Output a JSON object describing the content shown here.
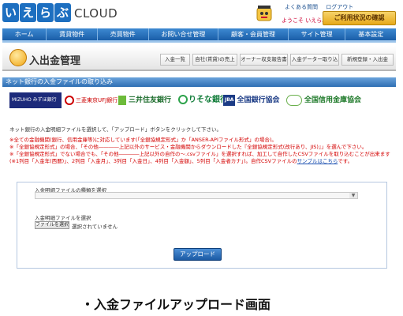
{
  "header": {
    "logo_chars": [
      "い",
      "え",
      "ら",
      "ぶ"
    ],
    "logo_suffix": "CLOUD",
    "top_links": [
      "よくある質問",
      "ログアウト"
    ],
    "welcome": "ようこそ いえらぶ 様",
    "usage_button": "ご利用状況の確認"
  },
  "nav": {
    "items": [
      "ホーム",
      "賃貸物件",
      "売買物件",
      "お問い合せ管理",
      "顧客・会員管理",
      "サイト管理",
      "基本設定"
    ]
  },
  "page": {
    "title": "入出金管理",
    "sub_tabs": [
      "入金一覧",
      "自社(賃貸)の売上",
      "オーナー収支報告書",
      "入金データー取り込",
      "新規登録・入出金"
    ]
  },
  "section": {
    "title": "ネット銀行の入金ファイルの取り込み"
  },
  "banks": {
    "mizuho": "MIZUHO みずほ銀行",
    "mufg": "三菱東京UFJ銀行",
    "smbc": "三井住友銀行",
    "resona": "りそな銀行",
    "zengin_mark": "JBA",
    "zengin": "全国銀行協会",
    "shinkin": "全国信用金庫協会"
  },
  "notes": {
    "instruction": "ネット銀行の入金明細ファイルを選択して、「アップロード」ボタンをクリックして下さい。",
    "line1": "※全ての金融機関(銀行、信用金庫等)に対応しています(「全銀協規定形式」か「ANSER-APIファイル形式」の場合)。",
    "line2": "※「全銀協規定形式」の場合、「その他――――上記以外のサービス・金融機関からダウンロードした『全銀協規定形式(改行あり、JIS)』」を選んで下さい。",
    "line3": "※「全銀協規定形式」でない場合でも、「その他――――上記以外の自作の～.csvファイル」を選択すれば、加工して自作したCSVファイルを取り込むことが出来ます(※1列目「入金年(西暦)」、2列目「入金月」、3列目「入金日」、4列目「入金額」、5列目「入金者カナ」)。自作CSVファイルの",
    "sample_link": "サンプルはこちら",
    "line3_end": "です。"
  },
  "form": {
    "select_label": "入金明細ファイルの種類を選択",
    "select_value": "",
    "file_label": "入金明細ファイルを選択",
    "file_button": "ファイルを選択",
    "file_status": "選択されていません",
    "upload_button": "アップロード"
  },
  "caption": "・入金ファイルアップロード画面",
  "colors": {
    "nav": "#1a5ea8",
    "section": "#2f6fb3",
    "notes": "#d40000",
    "usage_button": "#e7a91a"
  }
}
